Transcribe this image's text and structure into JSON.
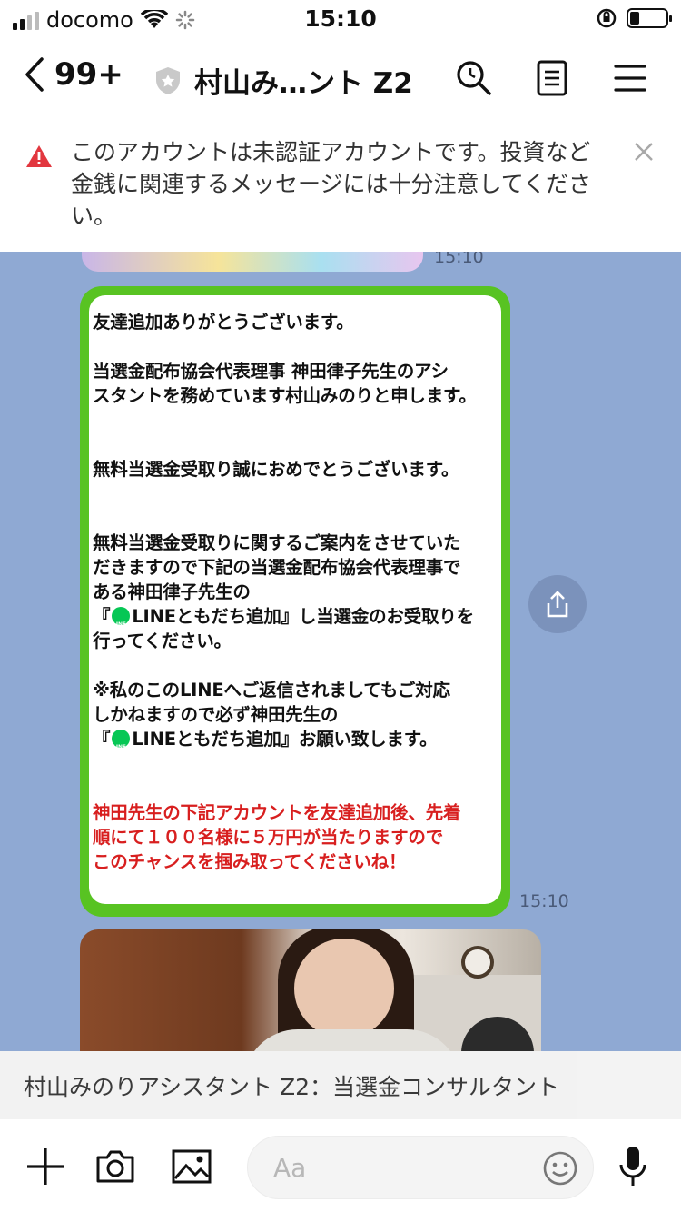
{
  "status_bar": {
    "carrier": "docomo",
    "time": "15:10",
    "battery_level": 0.25
  },
  "header": {
    "unread_count": "99+",
    "chat_title": "村山み…ント Z2",
    "icons": [
      "chevron-left-icon",
      "shield-star-icon",
      "search-icon",
      "notes-icon",
      "menu-icon"
    ]
  },
  "warning": {
    "text": "このアカウントは未認証アカウントです。投資など金銭に関連するメッセージには十分注意してください。"
  },
  "chat": {
    "top_image_time": "15:10",
    "message_time": "15:10",
    "message": {
      "line1": "友達追加ありがとうございます。",
      "line2a": "当選金配布協会代表理事 神田律子先生のアシ",
      "line2b": "スタントを務めています村山みのりと申します。",
      "line3": "無料当選金受取り誠におめでとうございます。",
      "line4a": "無料当選金受取りに関するご案内をさせていた",
      "line4b": "だきますので下記の当選金配布協会代表理事で",
      "line4c": "ある神田律子先生の",
      "line4d_pre": "『",
      "line4d_post": "LINEともだち追加』し当選金のお受取りを",
      "line4e": "行ってください。",
      "line5a": "※私のこのLINEへご返信されましてもご対応",
      "line5b": "しかねますので必ず神田先生の",
      "line5c_pre": "『",
      "line5c_post": "LINEともだち追加』お願い致します。",
      "red1": "神田先生の下記アカウントを友達追加後、先着",
      "red2": "順にて１００名様に５万円が当たりますので",
      "red3": "このチャンスを掴み取ってくださいね！"
    },
    "accent_green": "#58c322",
    "red_text_color": "#d81f1f"
  },
  "banner": {
    "text": "村山みのりアシスタント Z2：当選金コンサルタント"
  },
  "input_bar": {
    "placeholder": "Aa",
    "icons": [
      "plus-icon",
      "camera-icon",
      "image-icon",
      "emoji-icon",
      "microphone-icon"
    ]
  }
}
